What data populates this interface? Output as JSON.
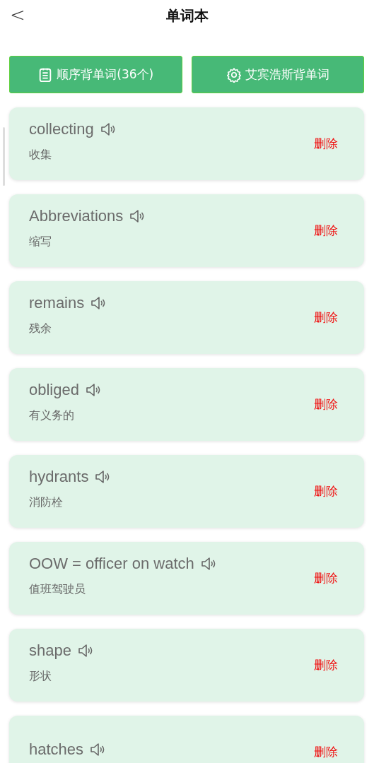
{
  "header": {
    "back": "<",
    "title": "单词本"
  },
  "actions": [
    {
      "kind": "list",
      "label": "顺序背单词(36个)"
    },
    {
      "kind": "gear",
      "label": "艾宾浩斯背单词"
    }
  ],
  "words": [
    {
      "word": "collecting",
      "meaning": "收集",
      "delete": "删除"
    },
    {
      "word": "Abbreviations",
      "meaning": "缩写",
      "delete": "删除"
    },
    {
      "word": "remains",
      "meaning": "残余",
      "delete": "删除"
    },
    {
      "word": "obliged",
      "meaning": "有义务的",
      "delete": "删除"
    },
    {
      "word": "hydrants",
      "meaning": "消防栓",
      "delete": "删除"
    },
    {
      "word": "OOW = officer on watch",
      "meaning": "值班驾驶员",
      "delete": "删除"
    },
    {
      "word": "shape",
      "meaning": "形状",
      "delete": "删除"
    },
    {
      "word": "hatches",
      "delete": "删除"
    }
  ]
}
